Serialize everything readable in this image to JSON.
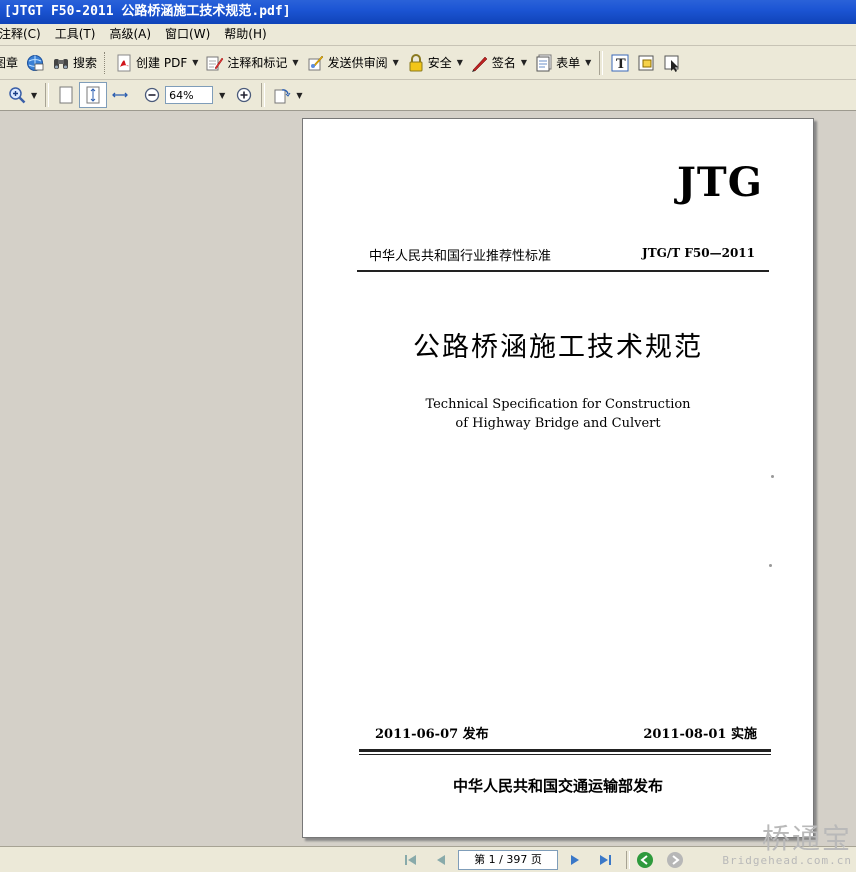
{
  "window": {
    "title": "[JTGT F50-2011 公路桥涵施工技术规范.pdf]"
  },
  "menu": {
    "items": [
      "注释(C)",
      "工具(T)",
      "高级(A)",
      "窗口(W)",
      "帮助(H)"
    ]
  },
  "toolbar1": {
    "stamp_label": "图章",
    "search_label": "搜索",
    "create_pdf_label": "创建 PDF",
    "comment_label": "注释和标记",
    "send_review_label": "发送供审阅",
    "security_label": "安全",
    "sign_label": "签名",
    "forms_label": "表单"
  },
  "toolbar2": {
    "zoom_value": "64%"
  },
  "document": {
    "logo": "JTG",
    "category": "中华人民共和国行业推荐性标准",
    "code": "JTG/T F50—2011",
    "title": "公路桥涵施工技术规范",
    "english_title_line1": "Technical Specification for Construction",
    "english_title_line2": "of Highway Bridge and Culvert",
    "issue_date": "2011-06-07 发布",
    "effective_date": "2011-08-01  实施",
    "publisher": "中华人民共和国交通运输部发布"
  },
  "statusbar": {
    "page_indicator": "第 1 / 397 页"
  },
  "watermark": {
    "cn": "桥通宝",
    "en": "Bridgehead.com.cn"
  },
  "colors": {
    "titlebar": "#1c55d4",
    "chrome": "#ece9d8",
    "viewport": "#d4d0c8"
  }
}
